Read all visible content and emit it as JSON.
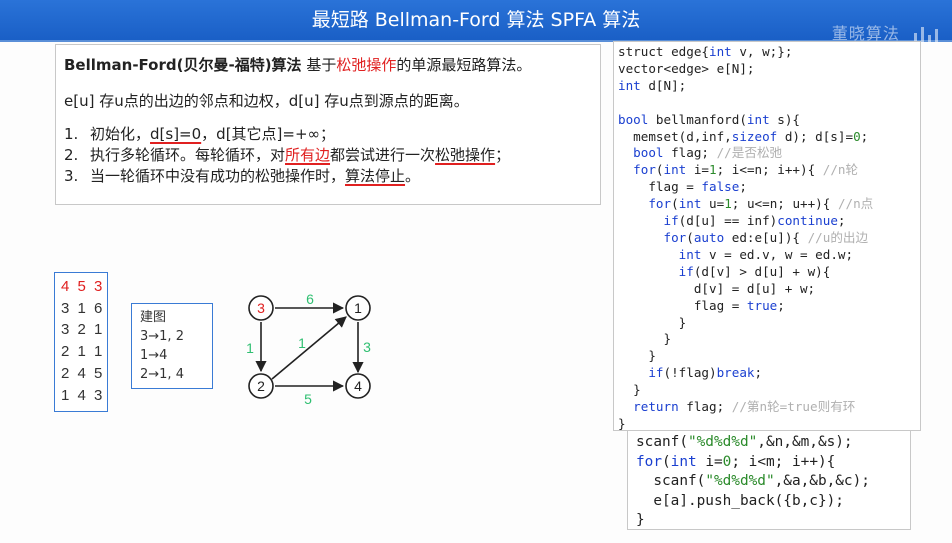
{
  "header": {
    "title": "最短路 Bellman-Ford 算法  SPFA 算法",
    "watermark": "董晓算法"
  },
  "description": {
    "head_bold": "Bellman-Ford(贝尔曼-福特)算法",
    "head_pre": " 基于",
    "head_red": "松弛操作",
    "head_post": "的单源最短路算法。",
    "line2": "e[u] 存u点的出边的邻点和边权，d[u] 存u点到源点的距离。",
    "steps": [
      {
        "num": "1.",
        "pre": "初始化，",
        "ul": "d[s]=0",
        "post": "，d[其它点]=+∞；",
        "ul2": "",
        "post2": ""
      },
      {
        "num": "2.",
        "pre": "执行多轮循环。每轮循环，对",
        "ul": "所有边",
        "post": "都尝试进行一次",
        "ul2": "松弛操作",
        "post2": "；"
      },
      {
        "num": "3.",
        "pre": "当一轮循环中没有成功的松弛操作时，",
        "ul": "算法停止",
        "post": "。",
        "ul2": "",
        "post2": ""
      }
    ]
  },
  "code_main": [
    [
      [
        "t",
        "struct edge{"
      ],
      [
        "kw",
        "int"
      ],
      [
        "t",
        " v, w;};"
      ]
    ],
    [
      [
        "t",
        "vector<edge> e[N];"
      ]
    ],
    [
      [
        "kw",
        "int"
      ],
      [
        "t",
        " d[N];"
      ]
    ],
    [
      [
        "t",
        ""
      ]
    ],
    [
      [
        "kw",
        "bool"
      ],
      [
        "t",
        " bellmanford("
      ],
      [
        "kw",
        "int"
      ],
      [
        "t",
        " s){"
      ]
    ],
    [
      [
        "t",
        "  memset(d,inf,"
      ],
      [
        "kw",
        "sizeof"
      ],
      [
        "t",
        " d); d[s]="
      ],
      [
        "st",
        "0"
      ],
      [
        "t",
        ";"
      ]
    ],
    [
      [
        "t",
        "  "
      ],
      [
        "kw",
        "bool"
      ],
      [
        "t",
        " flag; "
      ],
      [
        "cm",
        "//是否松弛"
      ]
    ],
    [
      [
        "t",
        "  "
      ],
      [
        "kw",
        "for"
      ],
      [
        "t",
        "("
      ],
      [
        "kw",
        "int"
      ],
      [
        "t",
        " i="
      ],
      [
        "st",
        "1"
      ],
      [
        "t",
        "; i<=n; i++){ "
      ],
      [
        "cm",
        "//n轮"
      ]
    ],
    [
      [
        "t",
        "    flag = "
      ],
      [
        "kw",
        "false"
      ],
      [
        "t",
        ";"
      ]
    ],
    [
      [
        "t",
        "    "
      ],
      [
        "kw",
        "for"
      ],
      [
        "t",
        "("
      ],
      [
        "kw",
        "int"
      ],
      [
        "t",
        " u="
      ],
      [
        "st",
        "1"
      ],
      [
        "t",
        "; u<=n; u++){ "
      ],
      [
        "cm",
        "//n点"
      ]
    ],
    [
      [
        "t",
        "      "
      ],
      [
        "kw",
        "if"
      ],
      [
        "t",
        "(d[u] == inf)"
      ],
      [
        "kw",
        "continue"
      ],
      [
        "t",
        ";"
      ]
    ],
    [
      [
        "t",
        "      "
      ],
      [
        "kw",
        "for"
      ],
      [
        "t",
        "("
      ],
      [
        "kw",
        "auto"
      ],
      [
        "t",
        " ed:e[u]){ "
      ],
      [
        "cm",
        "//u的出边"
      ]
    ],
    [
      [
        "t",
        "        "
      ],
      [
        "kw",
        "int"
      ],
      [
        "t",
        " v = ed.v, w = ed.w;"
      ]
    ],
    [
      [
        "t",
        "        "
      ],
      [
        "kw",
        "if"
      ],
      [
        "t",
        "(d[v] > d[u] + w){"
      ]
    ],
    [
      [
        "t",
        "          d[v] = d[u] + w;"
      ]
    ],
    [
      [
        "t",
        "          flag = "
      ],
      [
        "kw",
        "true"
      ],
      [
        "t",
        ";"
      ]
    ],
    [
      [
        "t",
        "        }"
      ]
    ],
    [
      [
        "t",
        "      }"
      ]
    ],
    [
      [
        "t",
        "    }"
      ]
    ],
    [
      [
        "t",
        "    "
      ],
      [
        "kw",
        "if"
      ],
      [
        "t",
        "(!flag)"
      ],
      [
        "kw",
        "break"
      ],
      [
        "t",
        ";"
      ]
    ],
    [
      [
        "t",
        "  }"
      ]
    ],
    [
      [
        "t",
        "  "
      ],
      [
        "kw",
        "return"
      ],
      [
        "t",
        " flag; "
      ],
      [
        "cm",
        "//第n轮=true则有环"
      ]
    ],
    [
      [
        "t",
        "}"
      ]
    ]
  ],
  "code_input": [
    [
      [
        "t",
        "scanf("
      ],
      [
        "st",
        "\"%d%d%d\""
      ],
      [
        "t",
        ",&n,&m,&s);"
      ]
    ],
    [
      [
        "kw",
        "for"
      ],
      [
        "t",
        "("
      ],
      [
        "kw",
        "int"
      ],
      [
        "t",
        " i="
      ],
      [
        "st",
        "0"
      ],
      [
        "t",
        "; i<m; i++){"
      ]
    ],
    [
      [
        "t",
        "  scanf("
      ],
      [
        "st",
        "\"%d%d%d\""
      ],
      [
        "t",
        ",&a,&b,&c);"
      ]
    ],
    [
      [
        "t",
        "  e[a].push_back({b,c});"
      ]
    ],
    [
      [
        "t",
        "}"
      ]
    ]
  ],
  "input_lines": [
    "4 5 3",
    "3 1 6",
    "3 2 1",
    "2 1 1",
    "2 4 5",
    "1 4 3"
  ],
  "build": {
    "title": "建图",
    "lines": [
      "3→1, 2",
      "1→4",
      "2→1, 4"
    ]
  },
  "graph": {
    "nodes": [
      {
        "id": "3",
        "label": "3",
        "source": true
      },
      {
        "id": "1",
        "label": "1",
        "source": false
      },
      {
        "id": "2",
        "label": "2",
        "source": false
      },
      {
        "id": "4",
        "label": "4",
        "source": false
      }
    ],
    "edge_weights": {
      "w31": "6",
      "w32": "1",
      "w21": "1",
      "w14": "3",
      "w24": "5"
    },
    "colors": {
      "source_node": "#e02020",
      "weight": "#2fbf71",
      "stroke": "#222222"
    }
  }
}
